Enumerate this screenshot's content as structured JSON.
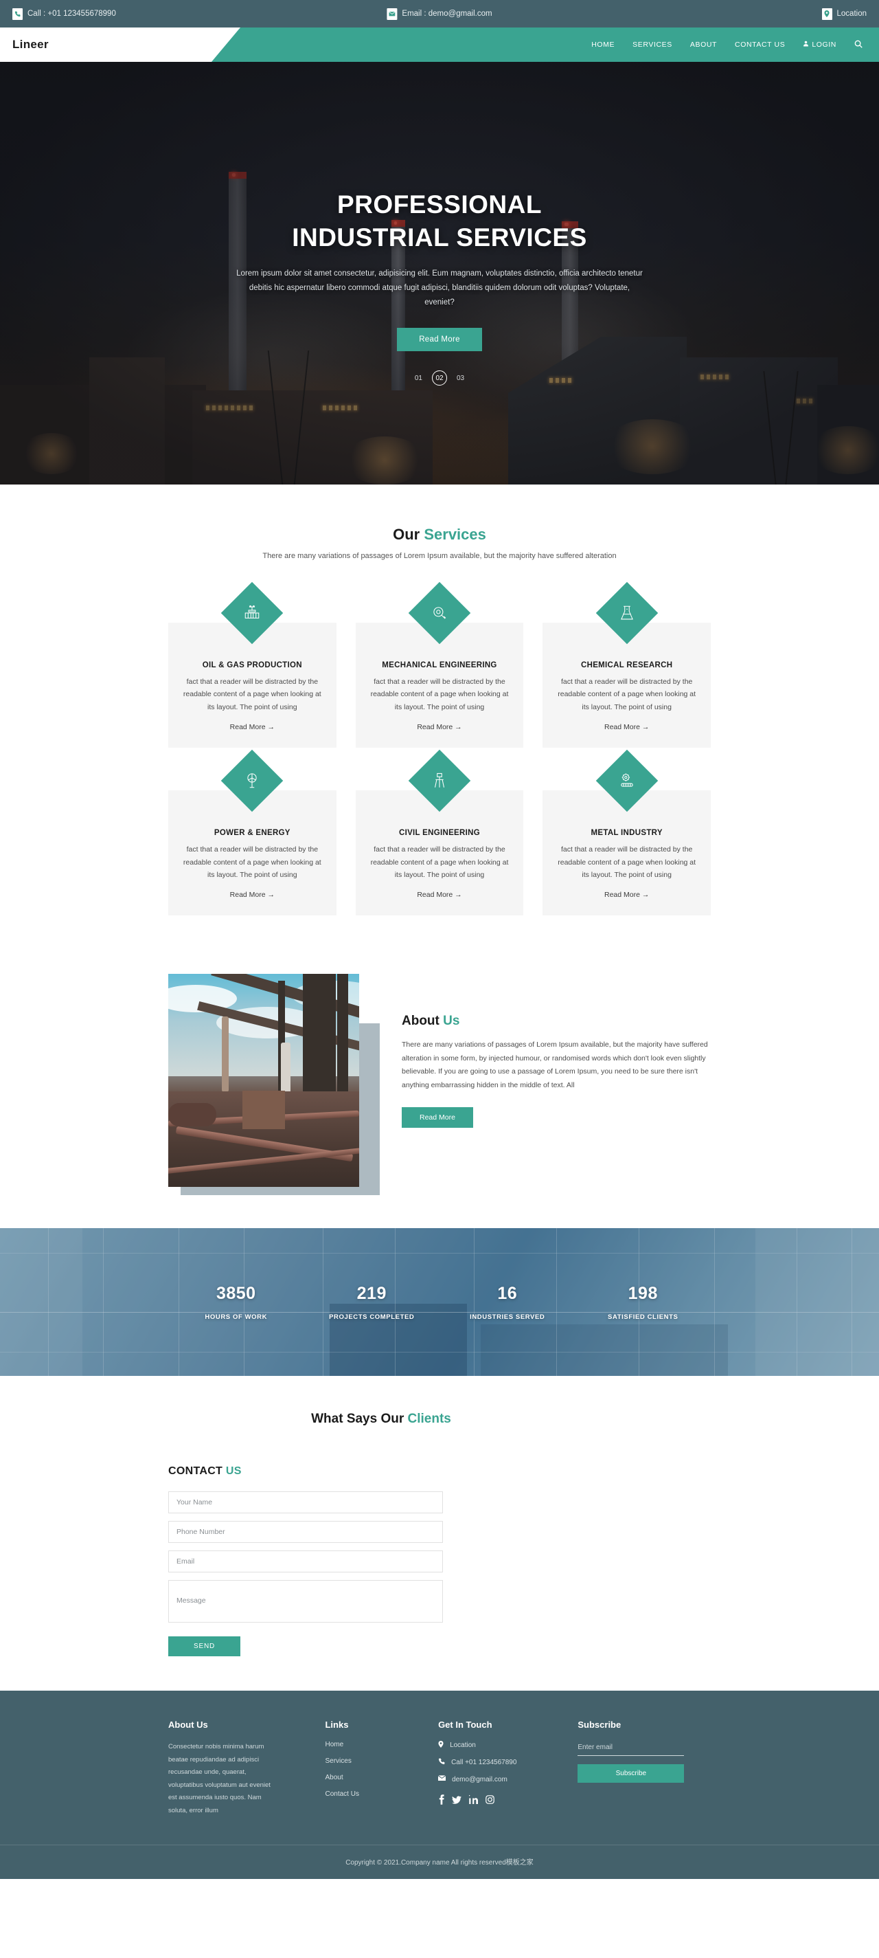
{
  "topbar": {
    "phone": "Call : +01 123455678990",
    "email": "Email : demo@gmail.com",
    "location": "Location"
  },
  "nav": {
    "logo": "Lineer",
    "links": [
      {
        "label": "HOME"
      },
      {
        "label": "SERVICES"
      },
      {
        "label": "ABOUT"
      },
      {
        "label": "CONTACT US"
      },
      {
        "label": "LOGIN"
      }
    ],
    "search_icon": "search-icon"
  },
  "hero": {
    "title_line1": "PROFESSIONAL",
    "title_line2": "INDUSTRIAL SERVICES",
    "subtitle": "Lorem ipsum dolor sit amet consectetur, adipisicing elit. Eum magnam, voluptates distinctio, officia architecto tenetur debitis hic aspernatur libero commodi atque fugit adipisci, blanditiis quidem dolorum odit voluptas? Voluptate, eveniet?",
    "button": "Read More",
    "slides": [
      "01",
      "02",
      "03"
    ],
    "active_slide": "02"
  },
  "services": {
    "title_plain": "Our ",
    "title_accent": "Services",
    "description": "There are many variations of passages of Lorem Ipsum available, but the majority have suffered alteration",
    "body_text": "fact that a reader will be distracted by the readable content of a page when looking at its layout. The point of using",
    "read_more": "Read More →",
    "items": [
      {
        "name": "OIL & GAS PRODUCTION",
        "icon": "valve-icon"
      },
      {
        "name": "MECHANICAL ENGINEERING",
        "icon": "gear-wrench-icon"
      },
      {
        "name": "CHEMICAL RESEARCH",
        "icon": "flask-icon"
      },
      {
        "name": "POWER & ENERGY",
        "icon": "wind-turbine-icon"
      },
      {
        "name": "CIVIL ENGINEERING",
        "icon": "surveyor-tripod-icon"
      },
      {
        "name": "METAL INDUSTRY",
        "icon": "gear-conveyor-icon"
      }
    ]
  },
  "about": {
    "title_plain": "About ",
    "title_accent": "Us",
    "body": "There are many variations of passages of Lorem Ipsum available, but the majority have suffered alteration in some form, by injected humour, or randomised words which don't look even slightly believable. If you are going to use a passage of Lorem Ipsum, you need to be sure there isn't anything embarrassing hidden in the middle of text. All",
    "button": "Read More",
    "image_alt": "industrial-plant-photo"
  },
  "stats": [
    {
      "value": "3850",
      "label": "HOURS OF WORK"
    },
    {
      "value": "219",
      "label": "PROJECTS COMPLETED"
    },
    {
      "value": "16",
      "label": "INDUSTRIES SERVED"
    },
    {
      "value": "198",
      "label": "SATISFIED CLIENTS"
    }
  ],
  "clients": {
    "title_plain": "What Says Our ",
    "title_accent": "Clients"
  },
  "contact": {
    "title_plain": "CONTACT ",
    "title_accent": "US",
    "fields": {
      "name_placeholder": "Your Name",
      "phone_placeholder": "Phone Number",
      "email_placeholder": "Email",
      "message_placeholder": "Message"
    },
    "send_label": "SEND"
  },
  "footer": {
    "about": {
      "heading": "About Us",
      "text": "Consectetur nobis minima harum beatae repudiandae ad adipisci recusandae unde, quaerat, voluptatibus voluptatum aut eveniet est assumenda iusto quos. Nam soluta, error illum"
    },
    "links": {
      "heading": "Links",
      "items": [
        {
          "label": "Home"
        },
        {
          "label": "Services"
        },
        {
          "label": "About"
        },
        {
          "label": "Contact Us"
        }
      ]
    },
    "touch": {
      "heading": "Get In Touch",
      "items": [
        {
          "label": "Location",
          "icon": "map-pin-icon"
        },
        {
          "label": "Call +01 1234567890",
          "icon": "phone-icon"
        },
        {
          "label": "demo@gmail.com",
          "icon": "envelope-icon"
        }
      ],
      "social": [
        {
          "icon": "facebook-icon"
        },
        {
          "icon": "twitter-icon"
        },
        {
          "icon": "linkedin-icon"
        },
        {
          "icon": "instagram-icon"
        }
      ]
    },
    "subscribe": {
      "heading": "Subscribe",
      "placeholder": "Enter email",
      "button": "Subscribe"
    },
    "copyright": "Copyright © 2021.Company name All rights reserved模板之家"
  },
  "colors": {
    "accent": "#3aa491",
    "dark_teal": "#44616b",
    "card_bg": "#f5f5f5"
  }
}
